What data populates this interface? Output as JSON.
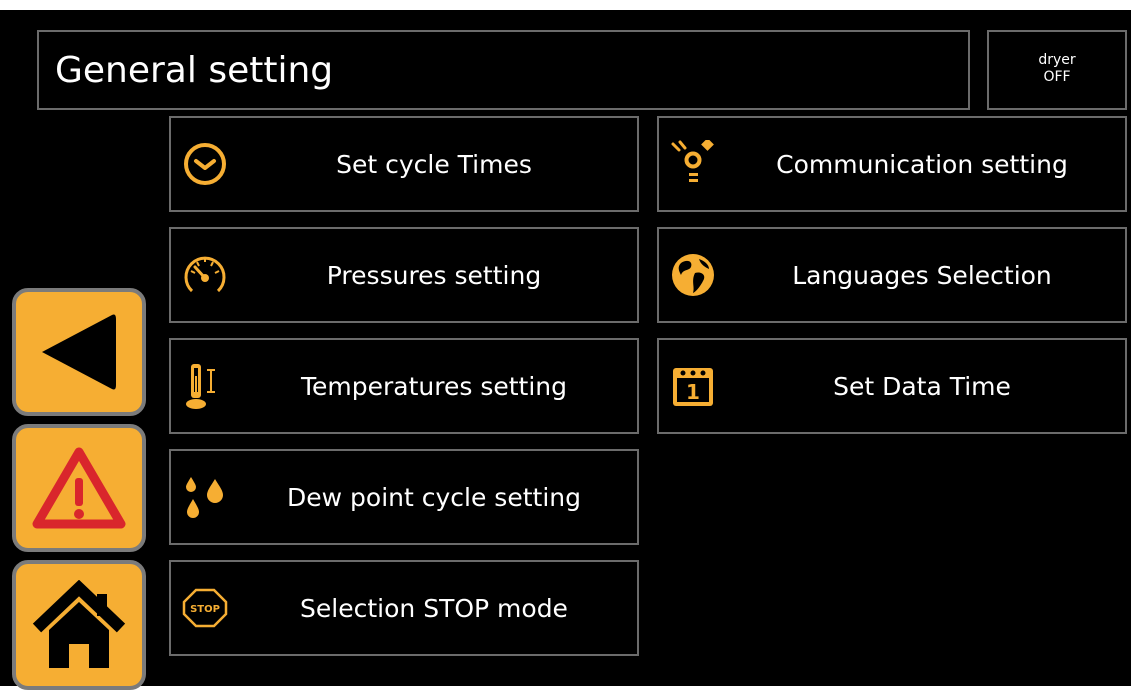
{
  "header": {
    "title": "General setting",
    "status_line1": "dryer",
    "status_line2": "OFF"
  },
  "menu": {
    "items": [
      {
        "label": "Set cycle Times",
        "icon": "clock-icon"
      },
      {
        "label": "Communication setting",
        "icon": "communication-icon"
      },
      {
        "label": "Pressures setting",
        "icon": "gauge-icon"
      },
      {
        "label": "Languages Selection",
        "icon": "globe-icon"
      },
      {
        "label": "Temperatures setting",
        "icon": "thermometer-icon"
      },
      {
        "label": "Set Data Time",
        "icon": "calendar-icon"
      },
      {
        "label": "Dew point cycle setting",
        "icon": "drops-icon"
      },
      {
        "label": "Selection STOP mode",
        "icon": "stop-sign-icon"
      }
    ],
    "stop_icon_text": "STOP",
    "calendar_icon_text": "1"
  },
  "side": {
    "buttons": [
      "back-arrow-icon",
      "warning-icon",
      "home-icon"
    ]
  },
  "colors": {
    "accent": "#f6ae33",
    "background": "#000000",
    "border": "#6b6b6b",
    "warning_red": "#d9262c",
    "text": "#ffffff"
  }
}
